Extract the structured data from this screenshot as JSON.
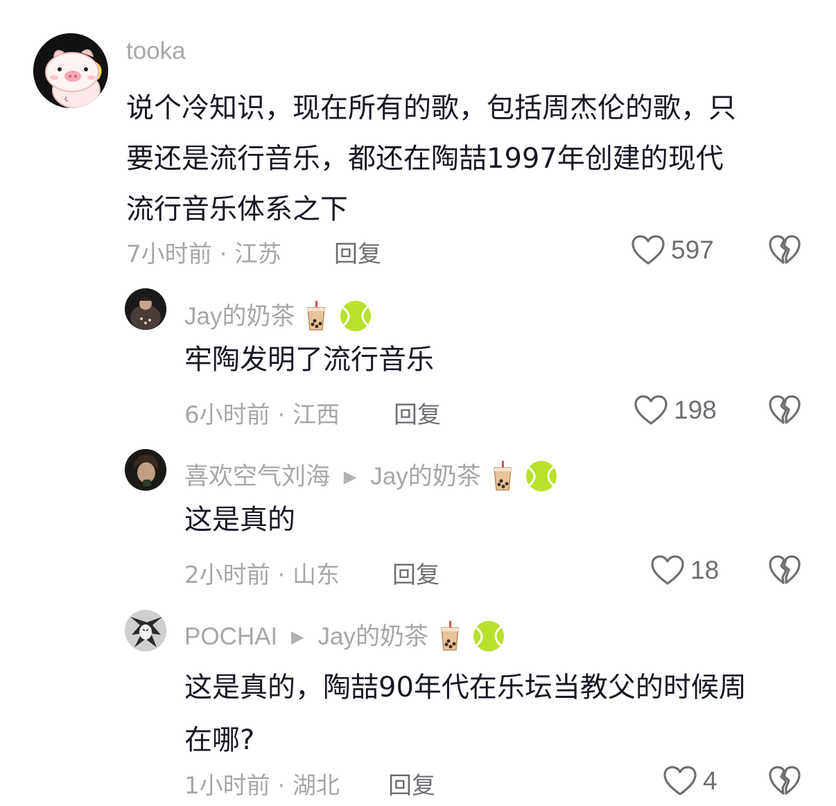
{
  "comments": [
    {
      "username": "tooka",
      "text_lines": [
        "说个冷知识，现在所有的歌，包括周杰伦的歌，只",
        "要还是流行音乐，都还在陶喆1997年创建的现代",
        "流行音乐体系之下"
      ],
      "meta": "7小时前 · 江苏",
      "reply_label": "回复",
      "likes": "597",
      "avatar_icon": "pig-avatar-icon"
    },
    {
      "username": "Jay的奶茶",
      "text_lines": [
        "牢陶发明了流行音乐"
      ],
      "meta": "6小时前 · 江西",
      "reply_label": "回复",
      "likes": "198",
      "emojis": [
        "bubble-tea-icon",
        "tennis-ball-icon"
      ]
    },
    {
      "username": "喜欢空气刘海",
      "reply_to": "Jay的奶茶",
      "text_lines": [
        "这是真的"
      ],
      "meta": "2小时前 · 山东",
      "reply_label": "回复",
      "likes": "18",
      "emojis": [
        "bubble-tea-icon",
        "tennis-ball-icon"
      ]
    },
    {
      "username": "POCHAI",
      "reply_to": "Jay的奶茶",
      "text_lines": [
        "这是真的，陶喆90年代在乐坛当教父的时候周",
        "在哪?"
      ],
      "meta": "1小时前 · 湖北",
      "reply_label": "回复",
      "likes": "4",
      "emojis": [
        "bubble-tea-icon",
        "tennis-ball-icon"
      ]
    }
  ],
  "colors": {
    "text": "#161823",
    "secondary": "#a7a7a9",
    "action": "#6d6e73"
  }
}
